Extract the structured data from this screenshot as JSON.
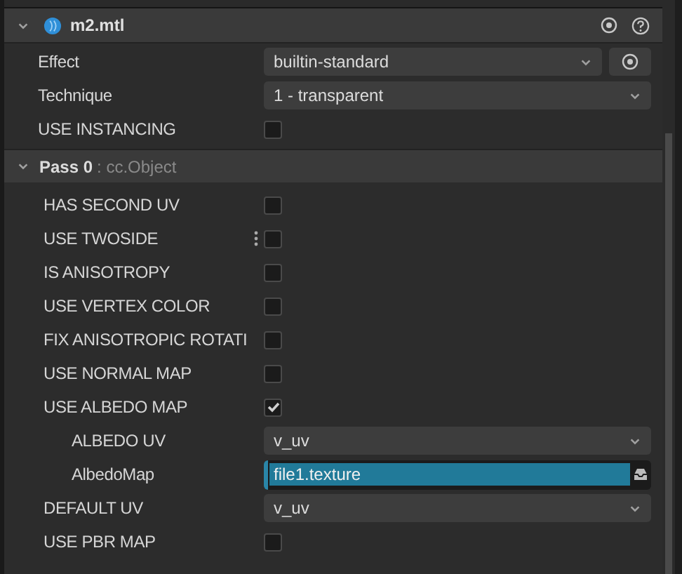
{
  "component": {
    "title": "m2.mtl",
    "expanded": true,
    "properties": [
      {
        "kind": "select",
        "label": "Effect",
        "value": "builtin-standard",
        "locate_button": true
      },
      {
        "kind": "select",
        "label": "Technique",
        "value": "1 - transparent",
        "locate_button": false
      },
      {
        "kind": "checkbox",
        "label": "USE INSTANCING",
        "checked": false
      }
    ]
  },
  "pass": {
    "title": "Pass 0",
    "subtitle": ": cc.Object",
    "expanded": true,
    "properties": [
      {
        "kind": "checkbox",
        "label": "HAS SECOND UV",
        "checked": false,
        "hovered": false
      },
      {
        "kind": "checkbox",
        "label": "USE TWOSIDE",
        "checked": false,
        "hovered": true
      },
      {
        "kind": "checkbox",
        "label": "IS ANISOTROPY",
        "checked": false,
        "hovered": false
      },
      {
        "kind": "checkbox",
        "label": "USE VERTEX COLOR",
        "checked": false,
        "hovered": false
      },
      {
        "kind": "checkbox",
        "label": "FIX ANISOTROPIC ROTATI",
        "checked": false,
        "hovered": false
      },
      {
        "kind": "checkbox",
        "label": "USE NORMAL MAP",
        "checked": false,
        "hovered": false
      },
      {
        "kind": "checkbox",
        "label": "USE ALBEDO MAP",
        "checked": true,
        "hovered": false,
        "children": [
          {
            "kind": "select",
            "label": "ALBEDO UV",
            "value": "v_uv",
            "hovered": false
          },
          {
            "kind": "asset",
            "label": "AlbedoMap",
            "value": "file1.texture",
            "selected": true,
            "hovered": false
          }
        ]
      },
      {
        "kind": "select",
        "label": "DEFAULT UV",
        "value": "v_uv",
        "hovered": false
      },
      {
        "kind": "checkbox",
        "label": "USE PBR MAP",
        "checked": false,
        "hovered": false
      }
    ]
  }
}
